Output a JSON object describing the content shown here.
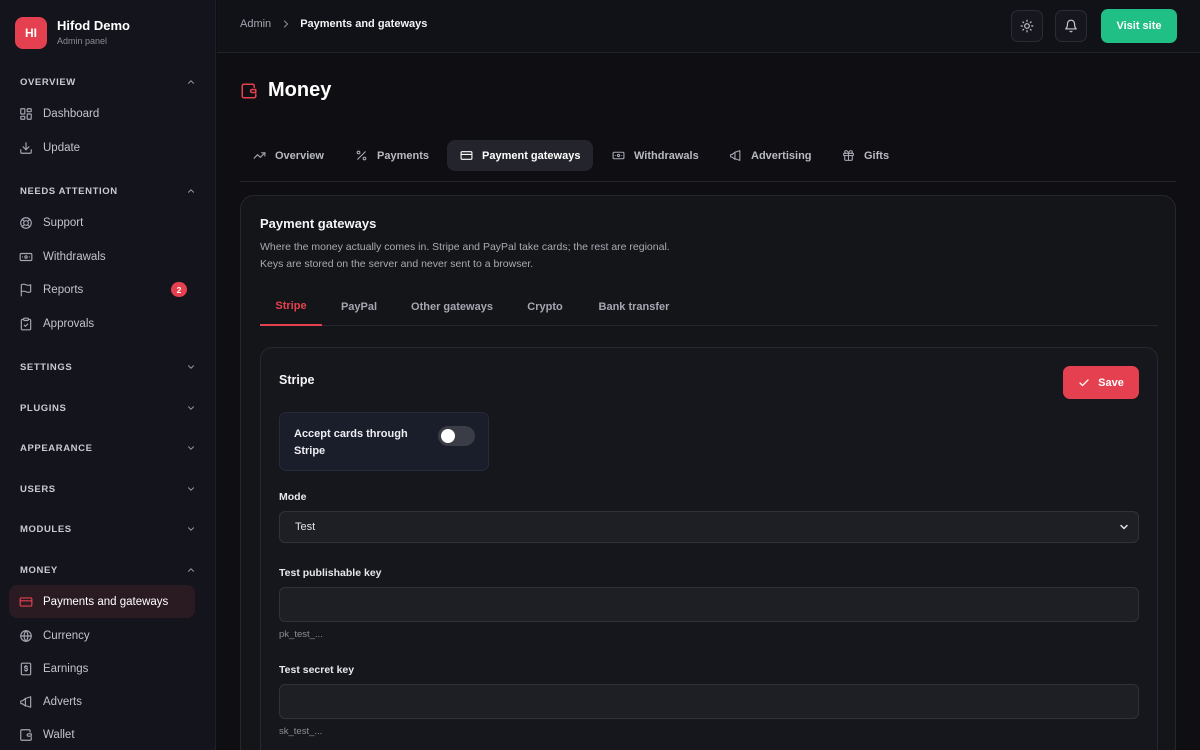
{
  "brand": {
    "initials": "HI",
    "name": "Hifod Demo",
    "subtitle": "Admin panel"
  },
  "sidebar": {
    "sections": [
      {
        "label": "OVERVIEW",
        "expanded": true
      },
      {
        "label": "NEEDS ATTENTION",
        "expanded": true
      },
      {
        "label": "SETTINGS",
        "expanded": false
      },
      {
        "label": "PLUGINS",
        "expanded": false
      },
      {
        "label": "APPEARANCE",
        "expanded": false
      },
      {
        "label": "USERS",
        "expanded": false
      },
      {
        "label": "MODULES",
        "expanded": false
      },
      {
        "label": "MONEY",
        "expanded": true
      }
    ],
    "items": [
      {
        "label": "Dashboard",
        "icon": "grid-icon"
      },
      {
        "label": "Update",
        "icon": "download-icon"
      },
      {
        "label": "Support",
        "icon": "lifebuoy-icon"
      },
      {
        "label": "Withdrawals",
        "icon": "banknote-icon"
      },
      {
        "label": "Reports",
        "icon": "flag-icon",
        "badge": "2"
      },
      {
        "label": "Approvals",
        "icon": "clipboard-check-icon"
      },
      {
        "label": "Payments and gateways",
        "icon": "credit-card-icon",
        "active": true
      },
      {
        "label": "Currency",
        "icon": "globe-icon"
      },
      {
        "label": "Earnings",
        "icon": "dollar-receipt-icon"
      },
      {
        "label": "Adverts",
        "icon": "megaphone-icon"
      },
      {
        "label": "Wallet",
        "icon": "wallet-icon"
      }
    ]
  },
  "topbar": {
    "breadcrumb_root": "Admin",
    "breadcrumb_current": "Payments and gateways",
    "visit_label": "Visit site"
  },
  "page": {
    "title": "Money",
    "icon": "wallet-icon"
  },
  "tabs": [
    {
      "label": "Overview",
      "icon": "trending-up-icon"
    },
    {
      "label": "Payments",
      "icon": "percent-icon"
    },
    {
      "label": "Payment gateways",
      "icon": "credit-card-icon",
      "active": true
    },
    {
      "label": "Withdrawals",
      "icon": "banknote-icon"
    },
    {
      "label": "Advertising",
      "icon": "megaphone-icon"
    },
    {
      "label": "Gifts",
      "icon": "gift-icon"
    }
  ],
  "card": {
    "title": "Payment gateways",
    "desc_line1": "Where the money actually comes in. Stripe and PayPal take cards; the rest are regional.",
    "desc_line2": "Keys are stored on the server and never sent to a browser."
  },
  "subtabs": [
    {
      "label": "Stripe",
      "active": true
    },
    {
      "label": "PayPal"
    },
    {
      "label": "Other gateways"
    },
    {
      "label": "Crypto"
    },
    {
      "label": "Bank transfer"
    }
  ],
  "stripe": {
    "title": "Stripe",
    "save_label": "Save",
    "toggle_label": "Accept cards through Stripe",
    "toggle_on": false,
    "mode_label": "Mode",
    "mode_value": "Test",
    "pub_key_label": "Test publishable key",
    "pub_key_value": "",
    "pub_key_hint": "pk_test_...",
    "secret_key_label": "Test secret key",
    "secret_key_value": "",
    "secret_key_hint": "sk_test_..."
  },
  "colors": {
    "accent": "#e5404f",
    "success": "#1fbf86",
    "background": "#0f0f13",
    "sidebar": "#13141c"
  }
}
